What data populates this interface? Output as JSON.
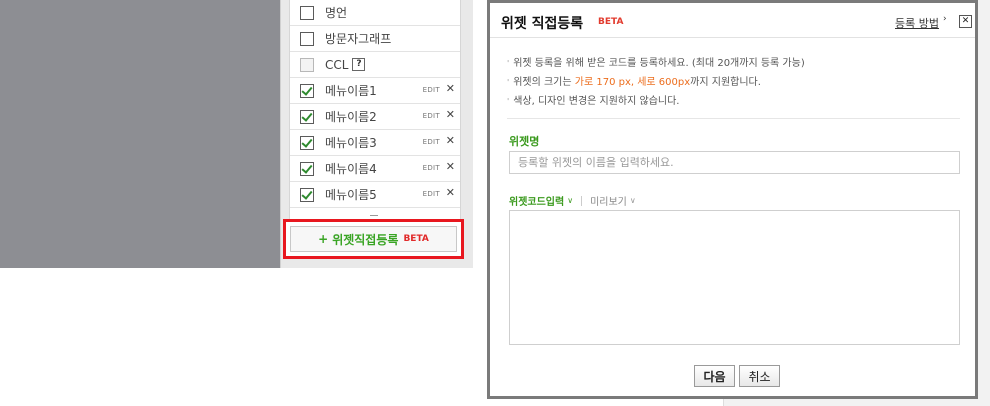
{
  "sidebar": {
    "items": [
      {
        "label": "명언",
        "checked": false,
        "disabled": false
      },
      {
        "label": "방문자그래프",
        "checked": false,
        "disabled": false
      },
      {
        "label": "CCL",
        "checked": false,
        "disabled": true,
        "help": "?"
      },
      {
        "label": "메뉴이름1",
        "checked": true,
        "edit": "EDIT",
        "remove": "✕"
      },
      {
        "label": "메뉴이름2",
        "checked": true,
        "edit": "EDIT",
        "remove": "✕"
      },
      {
        "label": "메뉴이름3",
        "checked": true,
        "edit": "EDIT",
        "remove": "✕"
      },
      {
        "label": "메뉴이름4",
        "checked": true,
        "edit": "EDIT",
        "remove": "✕"
      },
      {
        "label": "메뉴이름5",
        "checked": true,
        "edit": "EDIT",
        "remove": "✕"
      }
    ],
    "add_widget": {
      "plus": "+",
      "label": "위젯직접등록",
      "beta": "BETA"
    }
  },
  "dialog": {
    "title": "위젯 직접등록",
    "beta": "BETA",
    "help_link": "등록 방법",
    "help_arrow": "›",
    "close": "✕",
    "notes": {
      "line1": "위젯 등록을 위해 받은 코드를 등록하세요. (최대 20개까지 등록 가능)",
      "line2_pre": "위젯의 크기는 ",
      "line2_hl": "가로 170 px, 세로 600px",
      "line2_post": "까지 지원합니다.",
      "line3": "색상, 디자인 변경은 지원하지 않습니다."
    },
    "name_label": "위젯명",
    "name_placeholder": "등록할 위젯의 이름을 입력하세요.",
    "tab_code": "위젯코드입력",
    "tab_preview": "미리보기",
    "code_value": "",
    "next_button": "다음",
    "cancel_button": "취소"
  }
}
